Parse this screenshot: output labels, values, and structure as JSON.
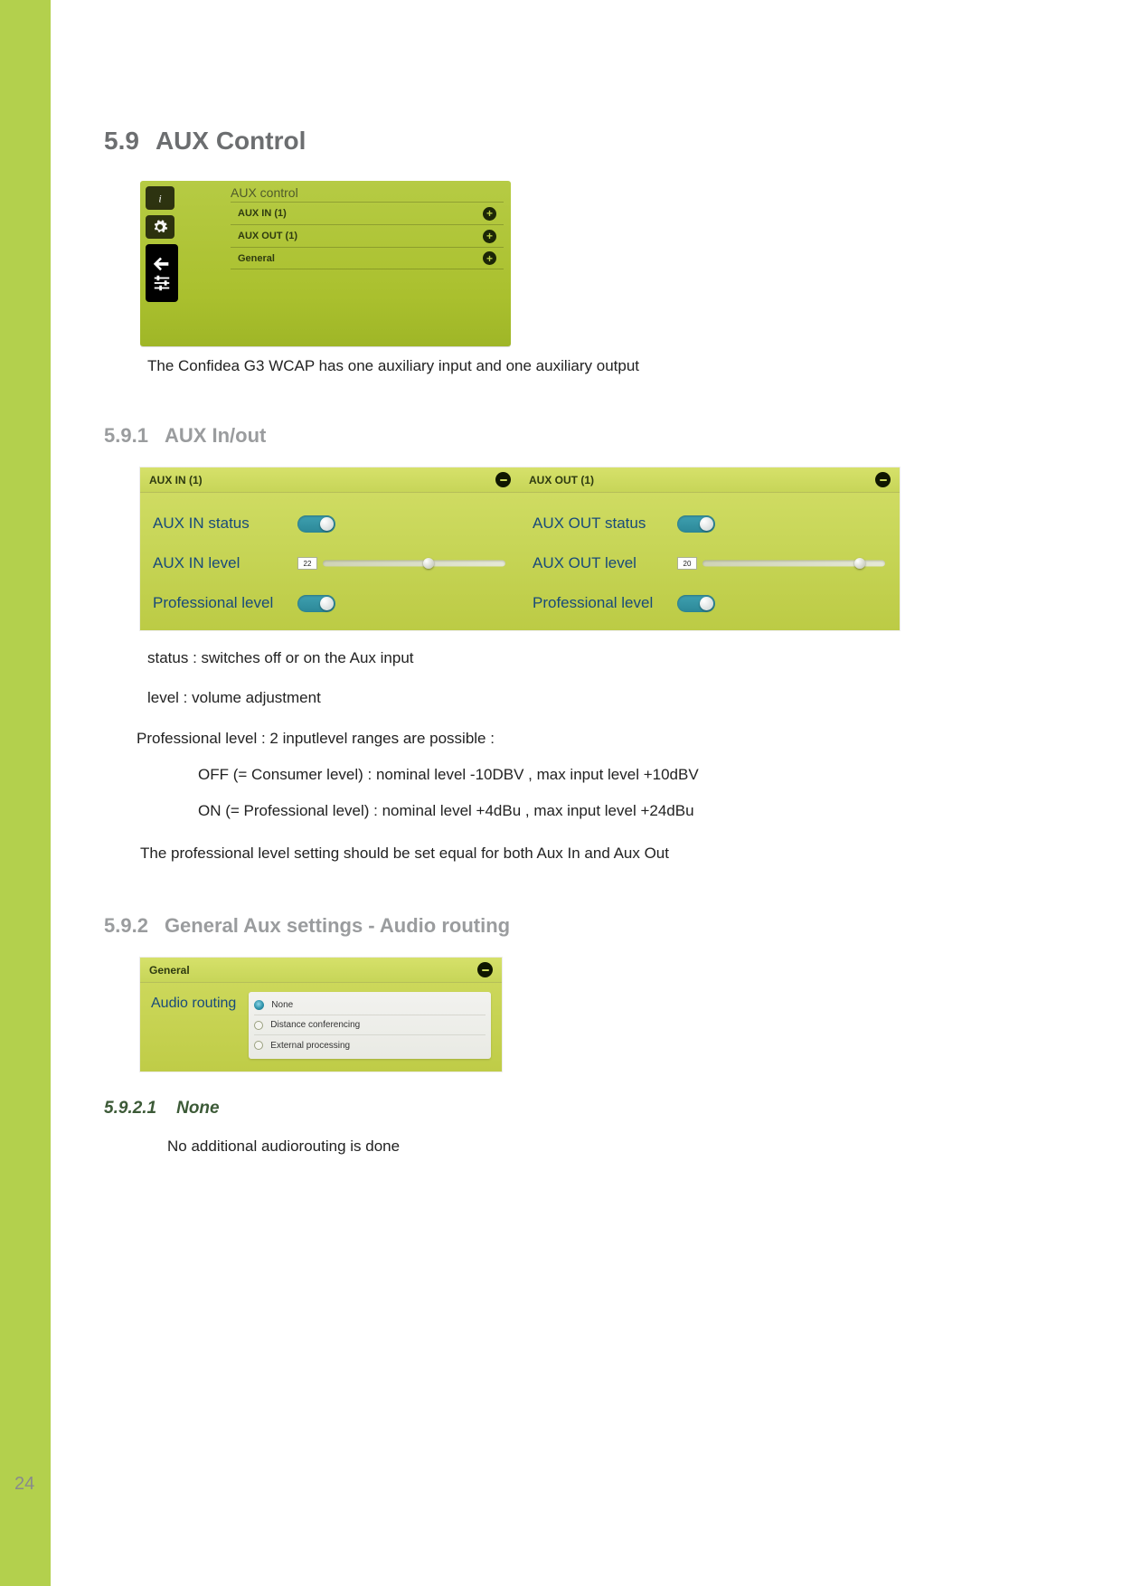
{
  "page_number": "24",
  "h2": {
    "num": "5.9",
    "title": "AUX Control"
  },
  "h3a": {
    "num": "5.9.1",
    "title": "AUX In/out"
  },
  "h3b": {
    "num": "5.9.2",
    "title": "General Aux settings - Audio routing"
  },
  "h4": {
    "num": "5.9.2.1",
    "title": "None"
  },
  "caption1": "The Confidea G3 WCAP has one auxiliary input and one auxiliary output",
  "descr": {
    "status": "status : switches off or on the Aux input",
    "level": "level : volume adjustment",
    "prof_intro": "Professional level : 2 inputlevel ranges are possible :",
    "prof_off": "OFF (= Consumer level)  : nominal level  -10DBV , max input level +10dBV",
    "prof_on": "ON (= Professional level) : nominal level +4dBu , max input level +24dBu",
    "prof_note": "The professional level setting should be set equal for both Aux In and Aux Out"
  },
  "none_text": "No additional audiorouting is done",
  "shot1": {
    "title": "AUX control",
    "rows": [
      "AUX IN (1)",
      "AUX OUT (1)",
      "General"
    ]
  },
  "aux_in": {
    "header": "AUX IN (1)",
    "rows": {
      "status": "AUX IN status",
      "level": "AUX IN level",
      "prof": "Professional level"
    },
    "level_value": "22",
    "level_thumb_pct": 58
  },
  "aux_out": {
    "header": "AUX OUT (1)",
    "rows": {
      "status": "AUX OUT status",
      "level": "AUX OUT level",
      "prof": "Professional level"
    },
    "level_value": "20",
    "level_thumb_pct": 86
  },
  "shot3": {
    "header": "General",
    "label": "Audio routing",
    "options": [
      "None",
      "Distance conferencing",
      "External processing"
    ],
    "selected_index": 0
  }
}
